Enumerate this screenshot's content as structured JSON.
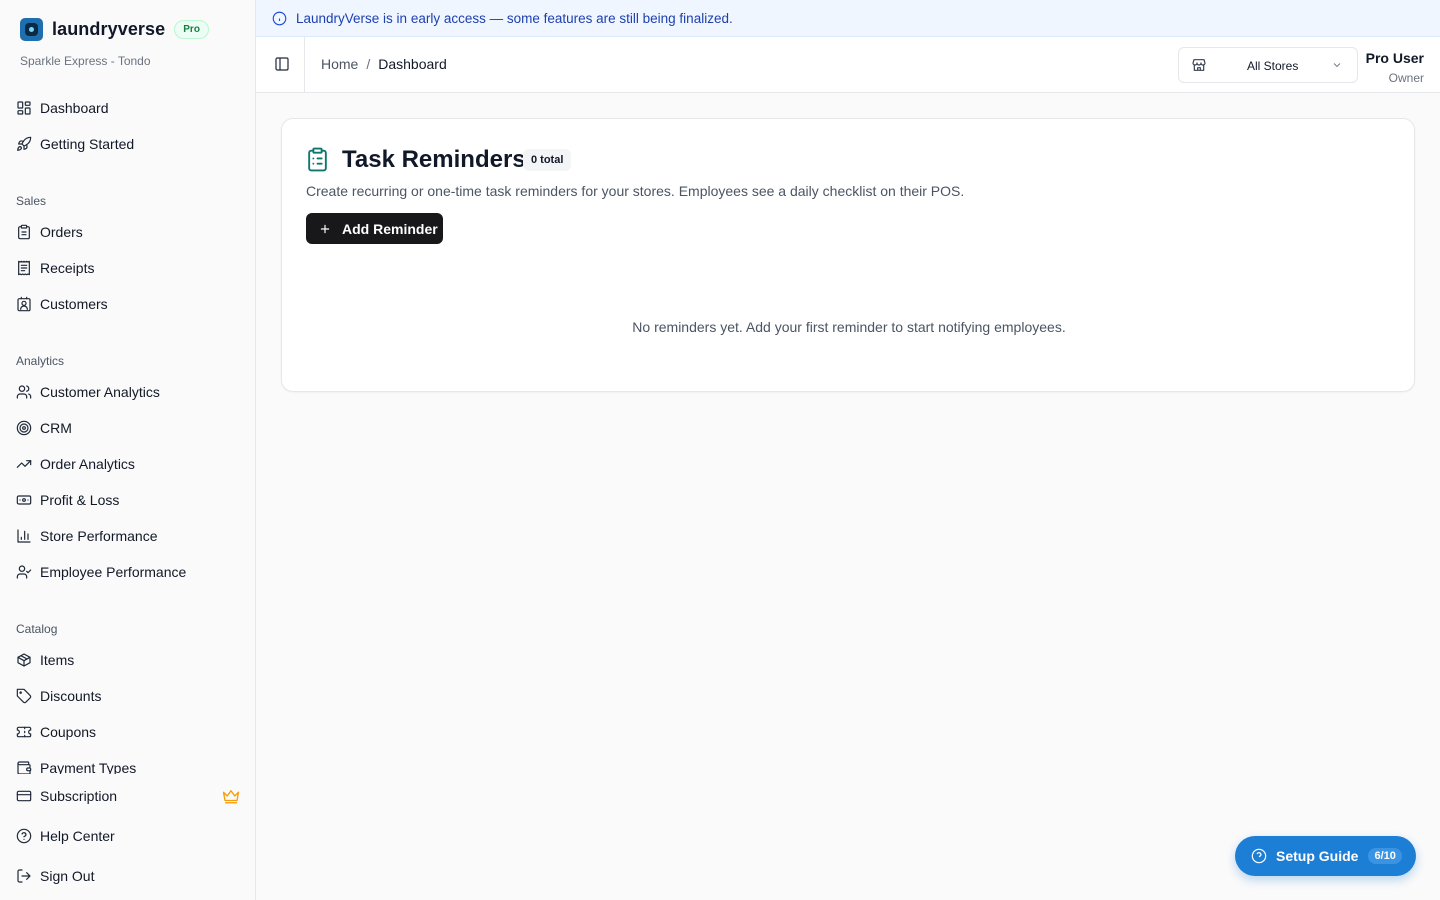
{
  "brand": {
    "name": "laundryverse",
    "plan_badge": "Pro",
    "store_name": "Sparkle Express - Tondo"
  },
  "sidebar": {
    "top_items": [
      {
        "label": "Dashboard",
        "icon": "layout-dashboard-icon"
      },
      {
        "label": "Getting Started",
        "icon": "rocket-icon"
      }
    ],
    "sections": [
      {
        "title": "Sales",
        "items": [
          {
            "label": "Orders",
            "icon": "clipboard-icon"
          },
          {
            "label": "Receipts",
            "icon": "receipt-icon"
          },
          {
            "label": "Customers",
            "icon": "contact-icon"
          }
        ]
      },
      {
        "title": "Analytics",
        "items": [
          {
            "label": "Customer Analytics",
            "icon": "users-icon"
          },
          {
            "label": "CRM",
            "icon": "target-icon"
          },
          {
            "label": "Order Analytics",
            "icon": "trending-up-icon"
          },
          {
            "label": "Profit & Loss",
            "icon": "banknote-icon"
          },
          {
            "label": "Store Performance",
            "icon": "bar-chart-icon"
          },
          {
            "label": "Employee Performance",
            "icon": "user-check-icon"
          }
        ]
      },
      {
        "title": "Catalog",
        "items": [
          {
            "label": "Items",
            "icon": "package-icon"
          },
          {
            "label": "Discounts",
            "icon": "tag-icon"
          },
          {
            "label": "Coupons",
            "icon": "ticket-icon"
          },
          {
            "label": "Payment Types",
            "icon": "wallet-icon"
          }
        ]
      }
    ],
    "bottom_items": [
      {
        "label": "Subscription",
        "icon": "credit-card-icon"
      },
      {
        "label": "Help Center",
        "icon": "help-circle-icon"
      },
      {
        "label": "Sign Out",
        "icon": "log-out-icon"
      }
    ]
  },
  "banner": {
    "text": "LaundryVerse is in early access — some features are still being finalized."
  },
  "header": {
    "breadcrumb": {
      "home": "Home",
      "separator": "/",
      "current": "Dashboard"
    },
    "store_select": {
      "value": "All Stores"
    },
    "user": {
      "name": "Pro User",
      "role": "Owner"
    }
  },
  "card": {
    "title": "Task Reminders",
    "count_badge": "0 total",
    "description": "Create recurring or one-time task reminders for your stores. Employees see a daily checklist on their POS.",
    "add_button": "Add Reminder",
    "empty_message": "No reminders yet. Add your first reminder to start notifying employees."
  },
  "setup_guide": {
    "label": "Setup Guide",
    "progress": "6/10"
  },
  "colors": {
    "accent": "#1d7ed6",
    "banner_text": "#1e40af",
    "pro_badge": "#15803d",
    "crown": "#f59e0b",
    "card_icon": "#0f766e"
  }
}
